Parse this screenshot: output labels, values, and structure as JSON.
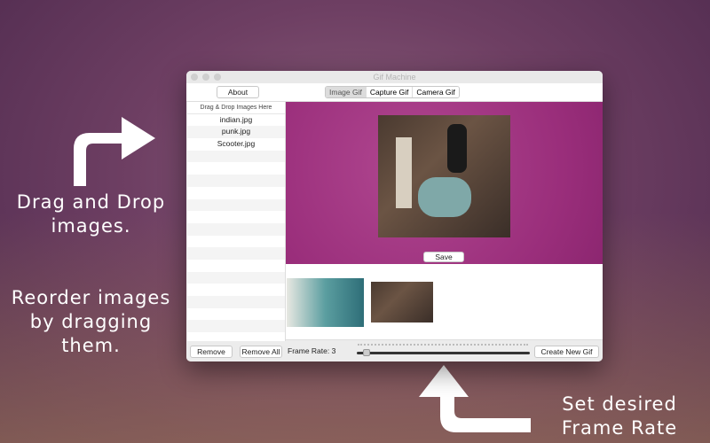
{
  "window": {
    "title": "Gif Machine"
  },
  "toolbar": {
    "about": "About",
    "tabs": [
      "Image Gif",
      "Capture Gif",
      "Camera Gif"
    ],
    "selected_tab": "Image Gif"
  },
  "sidebar": {
    "header": "Drag & Drop Images Here",
    "files": [
      "indian.jpg",
      "punk.jpg",
      "Scooter.jpg"
    ]
  },
  "preview": {
    "save": "Save"
  },
  "bottom": {
    "remove": "Remove",
    "remove_all": "Remove All",
    "frame_rate_label": "Frame Rate: 3",
    "frame_rate_value": 3,
    "slider_fraction": 0.04,
    "create": "Create New Gif"
  },
  "promo": {
    "drag": "Drag and Drop images.",
    "reorder": "Reorder images by dragging them.",
    "frame_rate": "Set desired Frame Rate"
  }
}
